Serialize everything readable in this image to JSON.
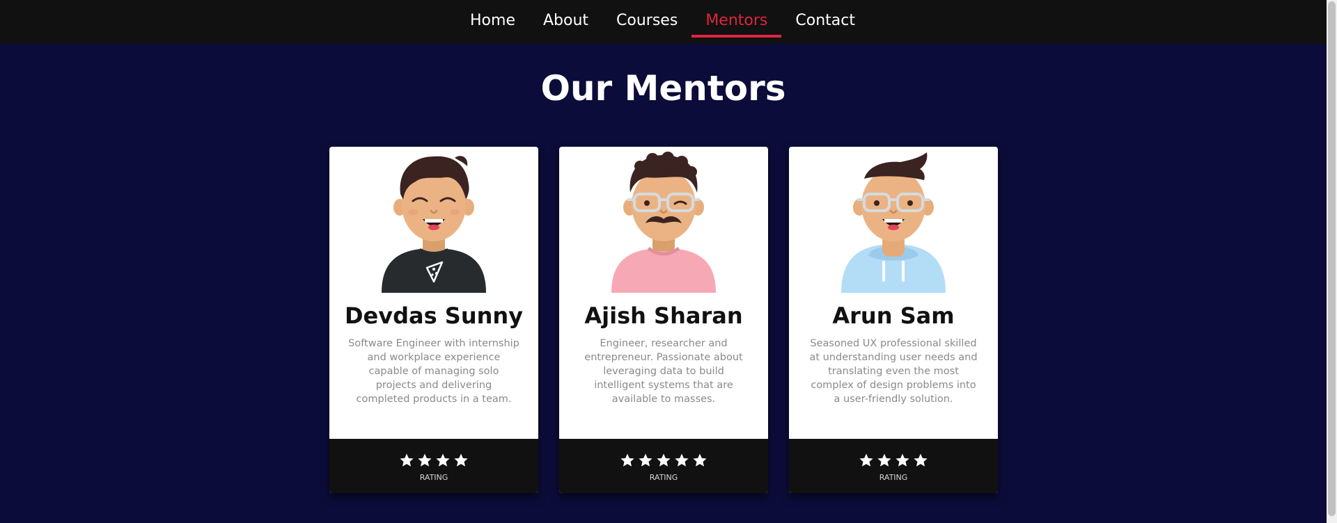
{
  "nav": {
    "items": [
      {
        "label": "Home",
        "active": false
      },
      {
        "label": "About",
        "active": false
      },
      {
        "label": "Courses",
        "active": false
      },
      {
        "label": "Mentors",
        "active": true
      },
      {
        "label": "Contact",
        "active": false
      }
    ]
  },
  "page": {
    "title": "Our Mentors"
  },
  "colors": {
    "background": "#0c0c3a",
    "navbar": "#111111",
    "accent": "#e0243e",
    "card": "#ffffff",
    "card_footer": "#111111",
    "description_text": "#8a8a8a"
  },
  "mentors": [
    {
      "name": "Devdas Sunny",
      "description": "Software Engineer with internship and workplace experience capable of managing solo projects and delivering completed products in a team.",
      "avatar_icon": "avatar-laughing-pizza-shirt-icon",
      "rating": 4,
      "rating_label": "RATING"
    },
    {
      "name": "Ajish Sharan",
      "description": "Engineer, researcher and entrepreneur. Passionate about leveraging data to build intelligent systems that are available to masses.",
      "avatar_icon": "avatar-glasses-mustache-icon",
      "rating": 5,
      "rating_label": "RATING"
    },
    {
      "name": "Arun Sam",
      "description": "Seasoned UX professional skilled at understanding user needs and translating even the most complex of design problems into a user-friendly solution.",
      "avatar_icon": "avatar-glasses-hoodie-icon",
      "rating": 4,
      "rating_label": "RATING"
    }
  ]
}
